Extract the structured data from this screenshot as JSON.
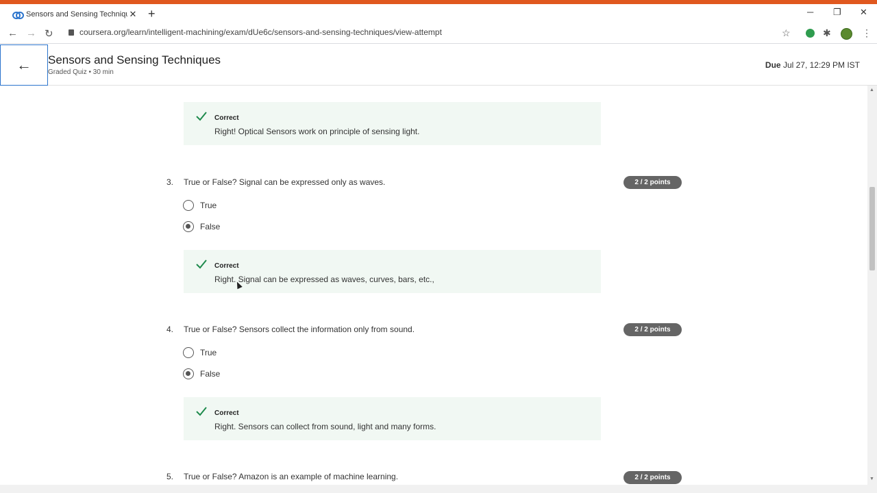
{
  "browser": {
    "tab_title": "Sensors and Sensing Techniques",
    "url": "coursera.org/learn/intelligent-machining/exam/dUe6c/sensors-and-sensing-techniques/view-attempt"
  },
  "header": {
    "title": "Sensors and Sensing Techniques",
    "subtitle": "Graded Quiz • 30 min",
    "due_label": "Due",
    "due_value": "Jul 27, 12:29 PM IST"
  },
  "feedback_prev": {
    "title": "Correct",
    "text": "Right! Optical Sensors work on principle of sensing light."
  },
  "questions": [
    {
      "number": "3.",
      "text": "True or False? Signal can be expressed only as waves.",
      "points": "2 / 2 points",
      "options": [
        "True",
        "False"
      ],
      "feedback_title": "Correct",
      "feedback_text": "Right. Signal can be expressed as waves, curves, bars, etc.,"
    },
    {
      "number": "4.",
      "text": "True or False? Sensors collect the information only from sound.",
      "points": "2 / 2 points",
      "options": [
        "True",
        "False"
      ],
      "feedback_title": "Correct",
      "feedback_text": "Right. Sensors can collect from sound, light and many forms."
    },
    {
      "number": "5.",
      "text": "True or False? Amazon is an example of machine learning.",
      "points": "2 / 2 points"
    }
  ],
  "colors": {
    "accent": "#2a73cc",
    "correct_bg": "#f1f8f3",
    "check": "#1e8a4c",
    "badge": "#656565"
  }
}
